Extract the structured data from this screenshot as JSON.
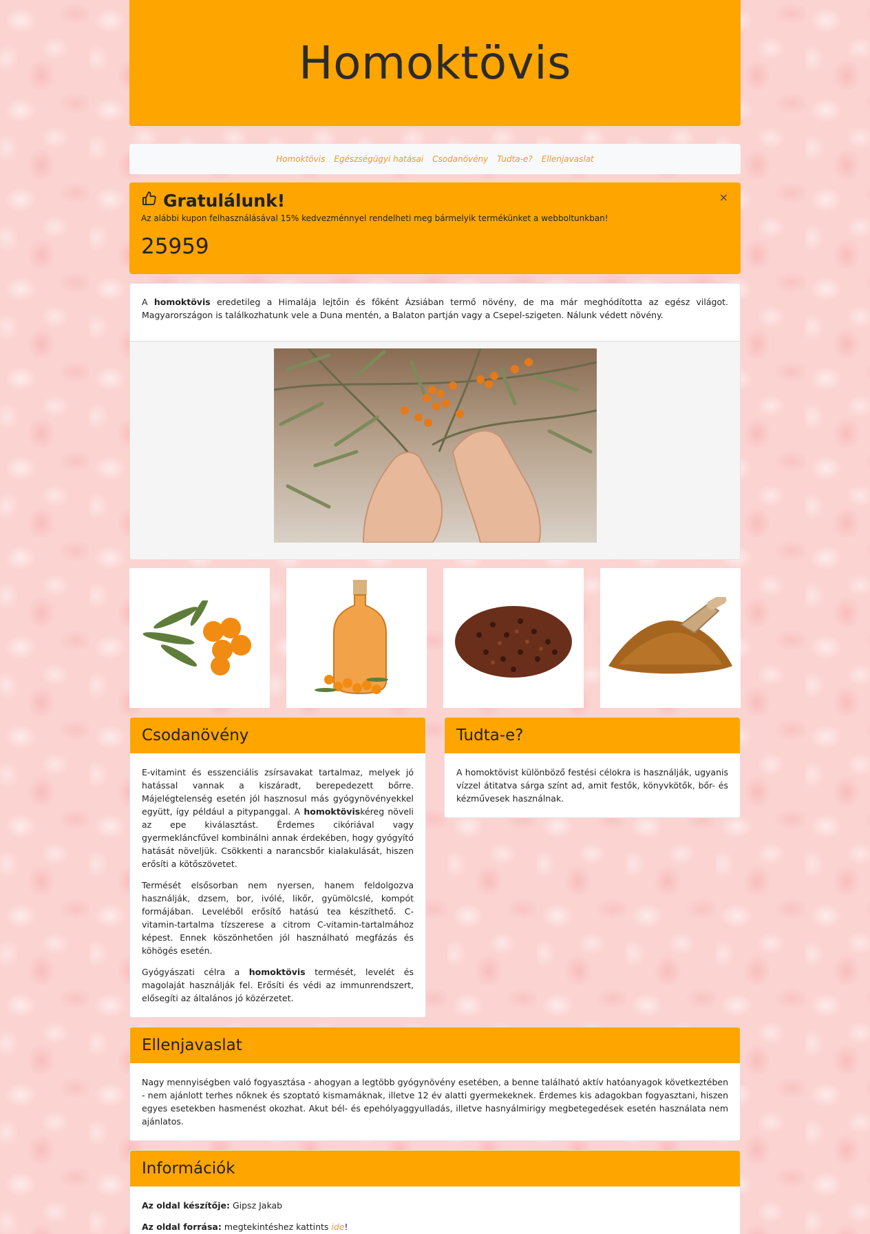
{
  "header": {
    "title": "Homoktövis"
  },
  "nav": {
    "items": [
      "Homoktövis",
      "Egészségügyi hatásai",
      "Csodanövény",
      "Tudta-e?",
      "Ellenjavaslat"
    ]
  },
  "alert": {
    "title": "Gratulálunk!",
    "text": "Az alábbi kupon felhasználásával 15% kedvezménnyel rendelheti meg bármelyik termékünket a webboltunkban!",
    "code": "25959",
    "close": "×"
  },
  "intro": {
    "pre": "A ",
    "bold": "homoktövis",
    "post": " eredetileg a Himalája lejtőin és főként Ázsiában termő növény, de ma már meghódította az egész világot. Magyarországon is találkozhatunk vele a Duna mentén, a Balaton partján vagy a Csepel-szigeten. Nálunk védett növény."
  },
  "images": {
    "main": "sea-buckthorn-harvest-photo",
    "thumbs": [
      "sea-buckthorn-berries-photo",
      "sea-buckthorn-oil-bottle-photo",
      "dried-berries-photo",
      "powder-with-scoop-photo"
    ]
  },
  "csodanoveny": {
    "title": "Csodanövény",
    "p1_pre": "E-vitamint és esszenciális zsírsavakat tartalmaz, melyek jó hatással vannak a kiszáradt, berepedezett bőrre. Májelégtelenség esetén jól hasznosul más gyógynövényekkel együtt, így például a pitypanggal. A ",
    "p1_bold": "homoktövis",
    "p1_post": "kéreg növeli az epe kiválasztást. Érdemes cikóriával vagy gyermekláncfűvel kombinálni annak érdekében, hogy gyógyító hatását növeljük. Csökkenti a narancsbőr kialakulását, hiszen erősíti a kötőszövetet.",
    "p2": "Termését elsősorban nem nyersen, hanem feldolgozva használják, dzsem, bor, ivólé, likőr, gyümölcslé, kompót formájában. Leveléből erősítő hatású tea készíthető. C-vitamin-tartalma tízszerese a citrom C-vitamin-tartalmához képest. Ennek köszönhetően jól használható megfázás és köhögés esetén.",
    "p3_pre": "Gyógyászati célra a ",
    "p3_bold": "homoktövis",
    "p3_post": " termését, levelét és magolaját használják fel. Erősíti és védi az immunrendszert, elősegíti az általános jó közérzetet."
  },
  "tudta": {
    "title": "Tudta-e?",
    "text": "A homoktövist különböző festési célokra is használják, ugyanis vízzel átitatva sárga színt ad, amit festők, könyvkötők, bőr- és kézművesek használnak."
  },
  "ellenjavaslat": {
    "title": "Ellenjavaslat",
    "text": "Nagy mennyiségben való fogyasztása - ahogyan a legtöbb gyógynövény esetében, a benne található aktív hatóanyagok következtében - nem ajánlott terhes nőknek és szoptató kismamáknak, illetve 12 év alatti gyermekeknek. Érdemes kis adagokban fogyasztani, hiszen egyes esetekben hasmenést okozhat. Akut bél- és epehólyaggyulladás, illetve hasnyálmirigy megbetegedések esetén használata nem ajánlatos."
  },
  "info": {
    "title": "Információk",
    "author_label": "Az oldal készítője:",
    "author": " Gipsz Jakab",
    "source_label": "Az oldal forrása:",
    "source_text": " megtekintéshez kattints ",
    "source_link": "ide",
    "source_end": "!"
  },
  "colors": {
    "accent": "#ffa500",
    "link": "#e89b2b",
    "background": "#fbd3d1"
  }
}
